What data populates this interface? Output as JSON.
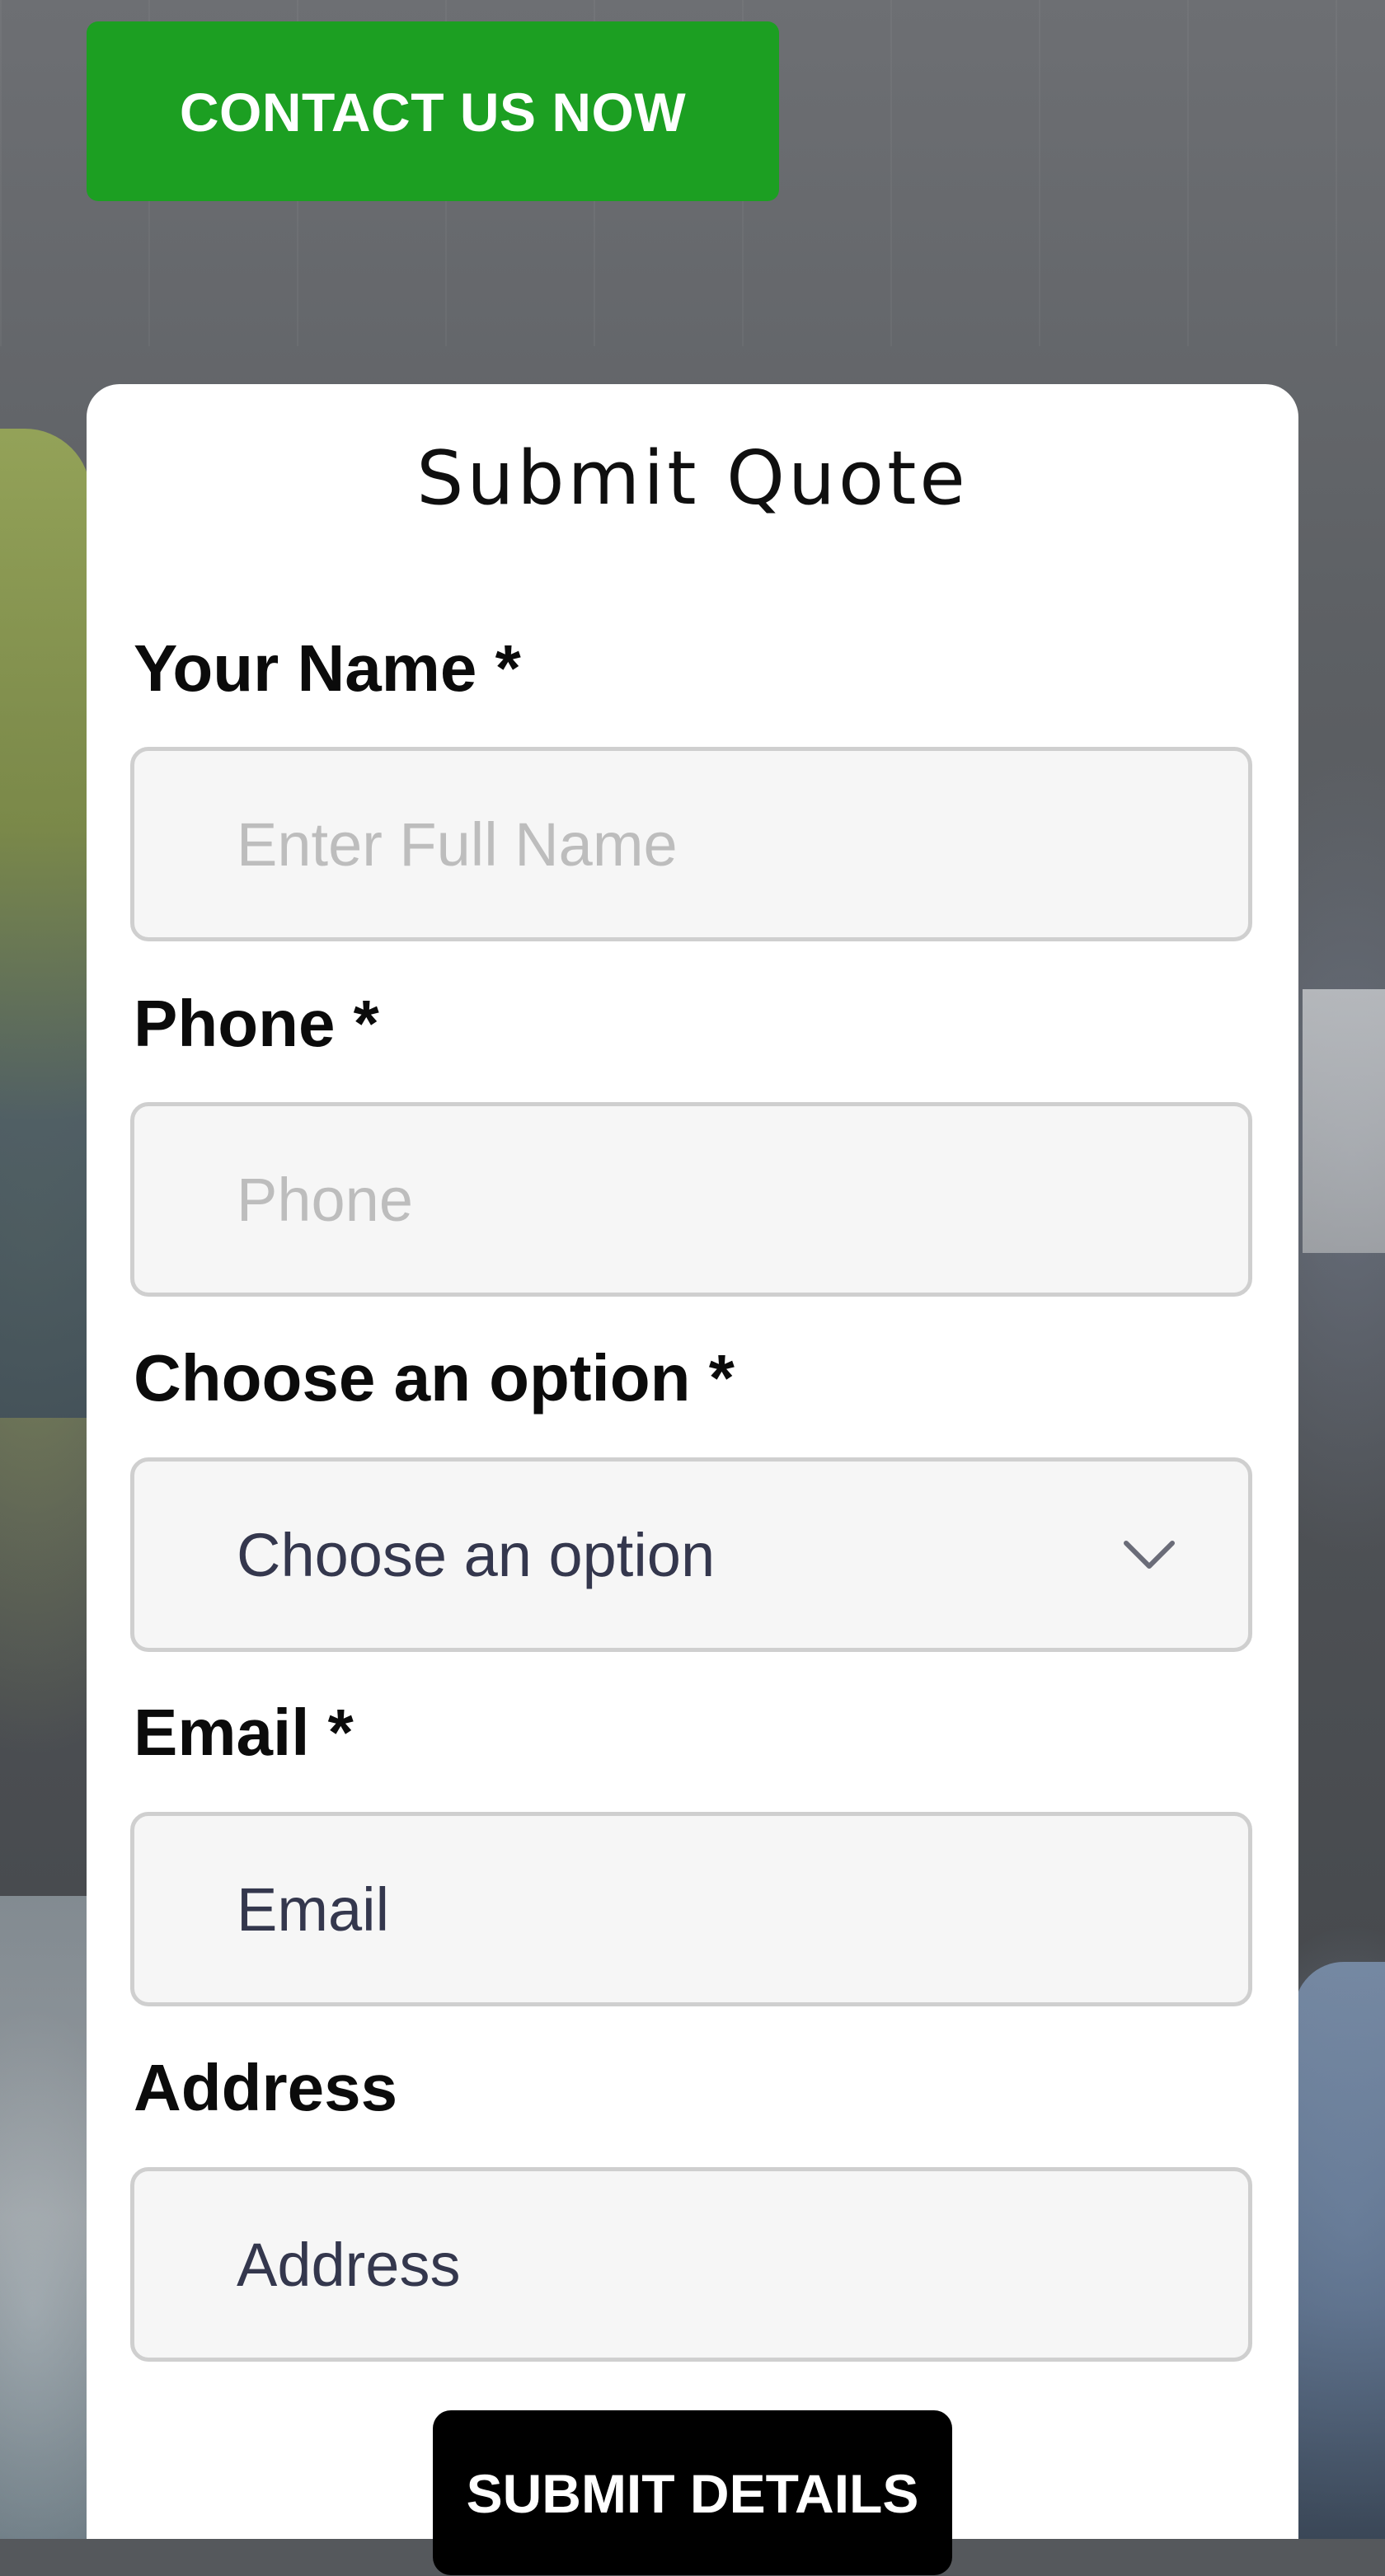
{
  "contact_button": {
    "label": "CONTACT US NOW"
  },
  "form": {
    "title": "Submit Quote",
    "fields": {
      "name": {
        "label": "Your Name *",
        "placeholder": "Enter Full Name",
        "value": ""
      },
      "phone": {
        "label": "Phone *",
        "placeholder": "Phone",
        "value": ""
      },
      "option": {
        "label": "Choose an option *",
        "selected": "Choose an option",
        "icon": "chevron-down-icon"
      },
      "email": {
        "label": "Email *",
        "placeholder": "Email",
        "value": ""
      },
      "address": {
        "label": "Address",
        "placeholder": "Address",
        "value": ""
      }
    },
    "submit_label": "SUBMIT DETAILS"
  },
  "colors": {
    "contact_button_bg": "#1c9f22",
    "submit_button_bg": "#000000",
    "input_bg": "#f6f6f6",
    "input_border": "#cfcfcf",
    "placeholder_light": "#bdbdbd",
    "placeholder_dark": "#34374d"
  }
}
